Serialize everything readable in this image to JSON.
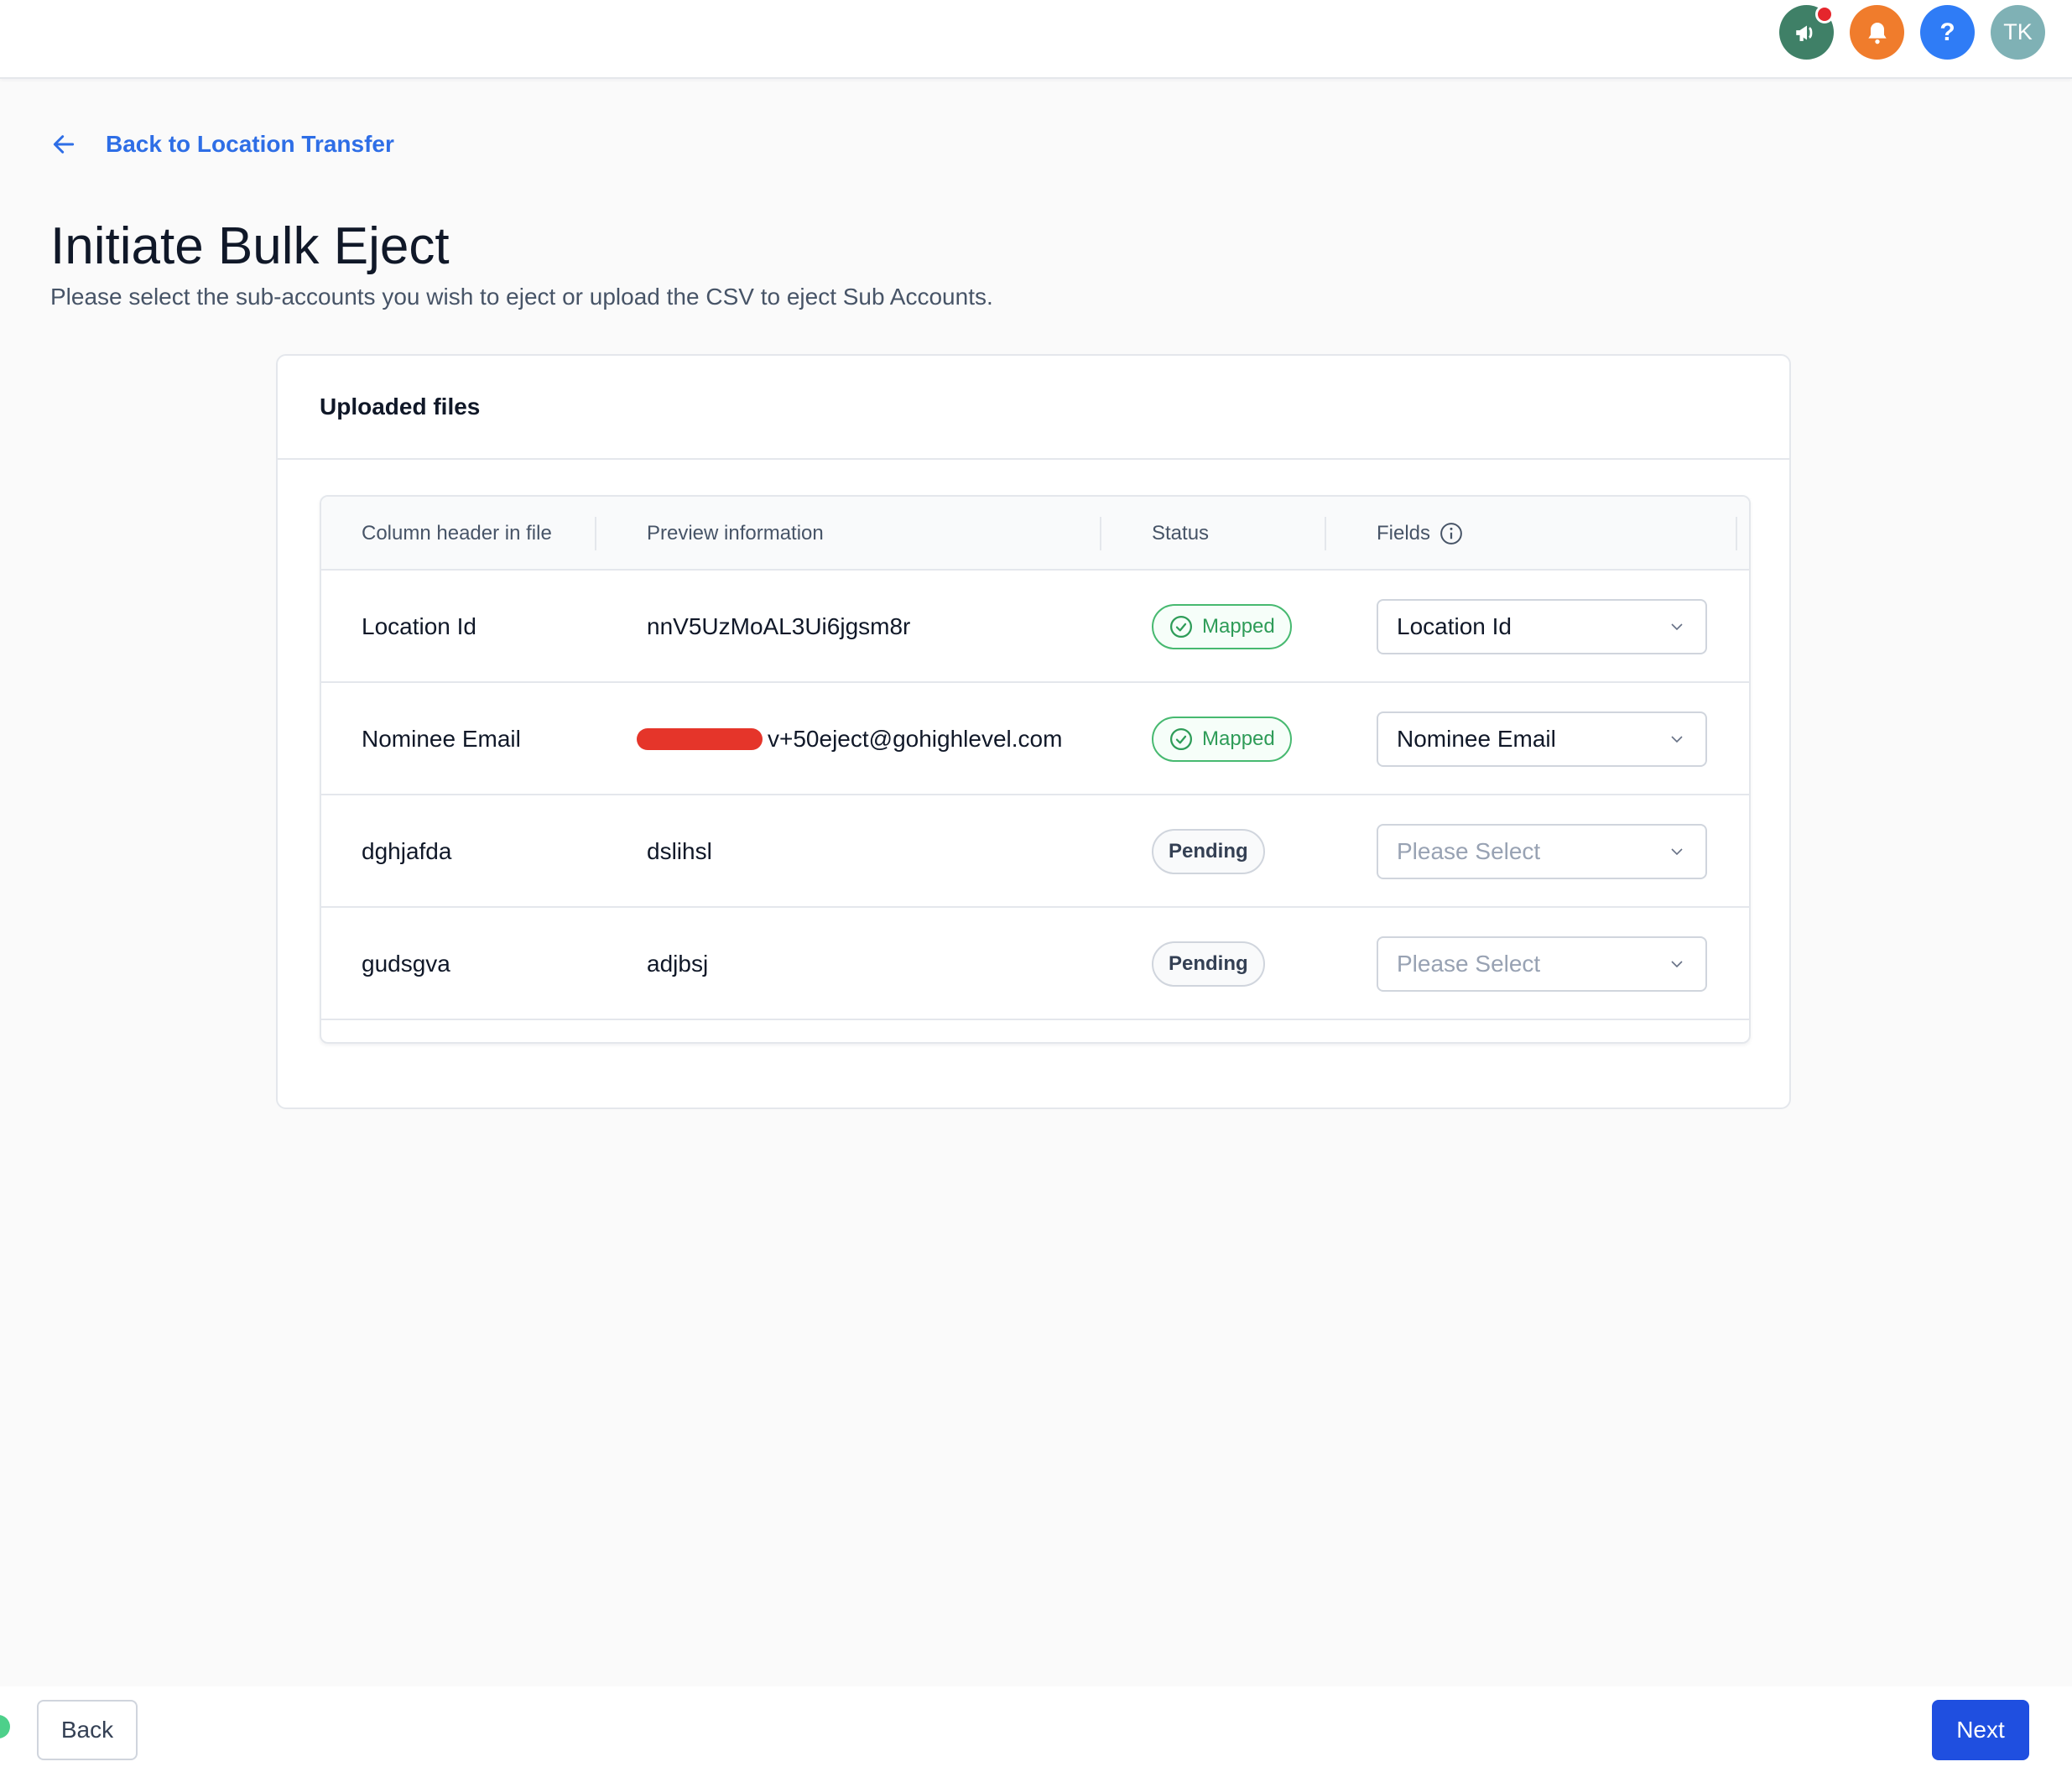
{
  "topbar": {
    "icons": [
      "megaphone-icon",
      "bell-icon",
      "help-icon"
    ],
    "help_glyph": "?",
    "avatar_initials": "TK",
    "colors": {
      "announce": "#3f8067",
      "bell": "#f07c2c",
      "help": "#2f7cf6",
      "avatar": "#7fb1b5",
      "notification_dot": "#e5262c"
    }
  },
  "back_link": {
    "label": "Back to Location Transfer"
  },
  "page": {
    "title": "Initiate Bulk Eject",
    "subtitle": "Please select the sub-accounts you wish to eject or upload the CSV to eject Sub Accounts."
  },
  "card": {
    "title": "Uploaded files",
    "table": {
      "headers": {
        "column": "Column header in file",
        "preview": "Preview information",
        "status": "Status",
        "fields": "Fields"
      },
      "rows": [
        {
          "column": "Location Id",
          "preview": "nnV5UzMoAL3Ui6jgsm8r",
          "status": "Mapped",
          "field": "Location Id"
        },
        {
          "column": "Nominee Email",
          "preview": "v+50eject@gohighlevel.com",
          "status": "Mapped",
          "field": "Nominee Email"
        },
        {
          "column": "dghjafda",
          "preview": "dslihsl",
          "status": "Pending",
          "field": "Please Select"
        },
        {
          "column": "gudsgva",
          "preview": "adjbsj",
          "status": "Pending",
          "field": "Please Select"
        }
      ]
    }
  },
  "footer": {
    "back_label": "Back",
    "next_label": "Next"
  },
  "accent": "#2e6ee6",
  "primary_button": "#1f4fe0"
}
